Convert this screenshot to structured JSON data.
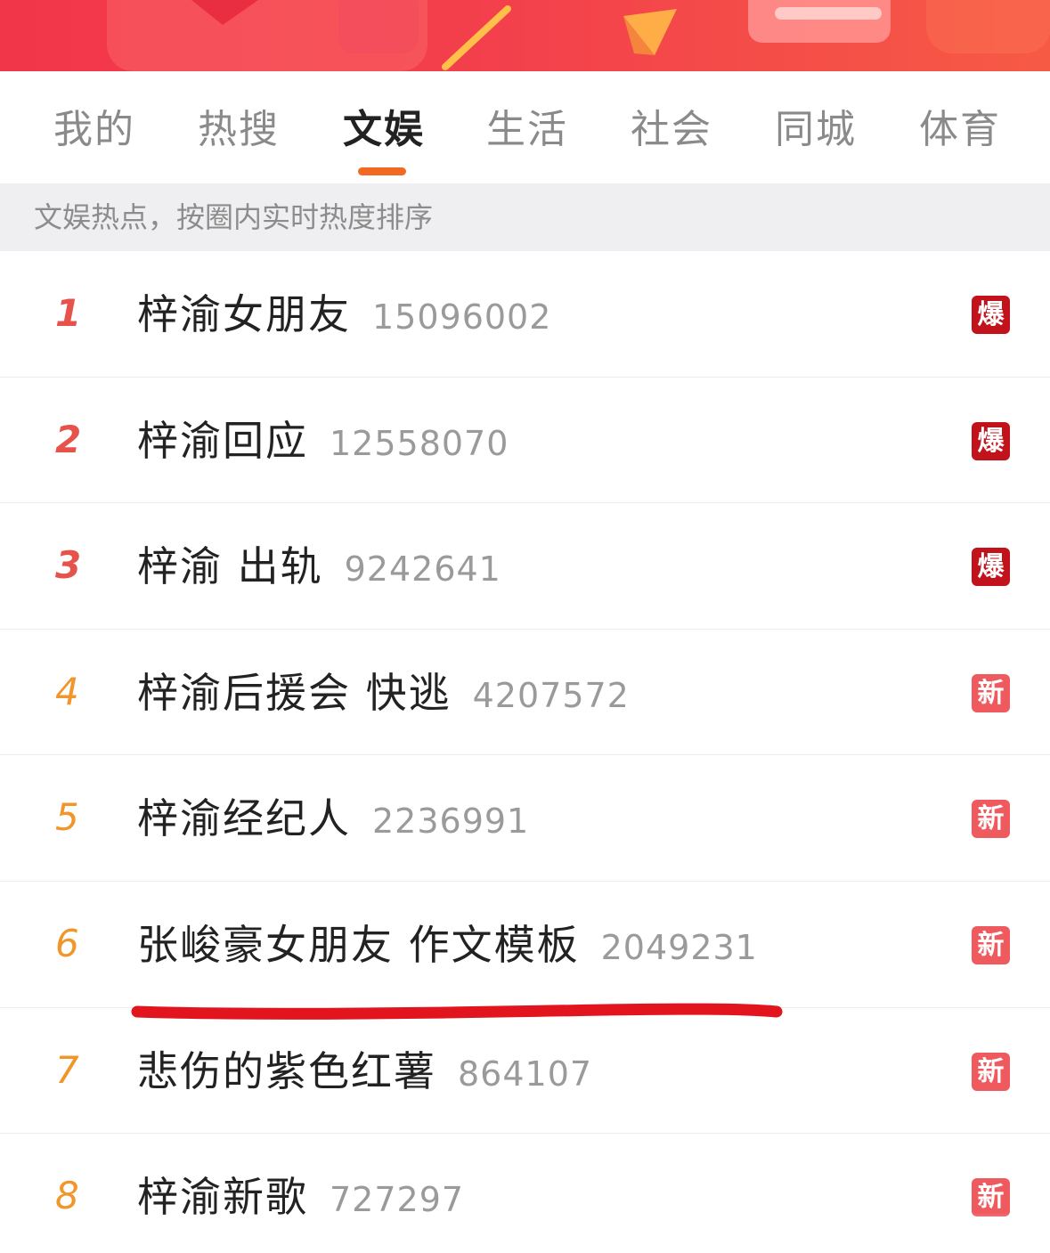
{
  "tabs": [
    {
      "label": "我的",
      "active": false
    },
    {
      "label": "热搜",
      "active": false
    },
    {
      "label": "文娱",
      "active": true
    },
    {
      "label": "生活",
      "active": false
    },
    {
      "label": "社会",
      "active": false
    },
    {
      "label": "同城",
      "active": false
    },
    {
      "label": "体育",
      "active": false
    }
  ],
  "info_text": "文娱热点，按圈内实时热度排序",
  "list": [
    {
      "rank": "1",
      "title": "梓渝女朋友",
      "count": "15096002",
      "badge": "爆"
    },
    {
      "rank": "2",
      "title": "梓渝回应",
      "count": "12558070",
      "badge": "爆"
    },
    {
      "rank": "3",
      "title": "梓渝 出轨",
      "count": "9242641",
      "badge": "爆"
    },
    {
      "rank": "4",
      "title": "梓渝后援会 快逃",
      "count": "4207572",
      "badge": "新"
    },
    {
      "rank": "5",
      "title": "梓渝经纪人",
      "count": "2236991",
      "badge": "新"
    },
    {
      "rank": "6",
      "title": "张峻豪女朋友 作文模板",
      "count": "2049231",
      "badge": "新"
    },
    {
      "rank": "7",
      "title": "悲伤的紫色红薯",
      "count": "864107",
      "badge": "新"
    },
    {
      "rank": "8",
      "title": "梓渝新歌",
      "count": "727297",
      "badge": "新"
    }
  ],
  "colors": {
    "accent": "#f26a21",
    "rank_top": "#e6534a",
    "rank_other": "#f0962a",
    "badge_hot": "#c2131c",
    "badge_new": "#ef5a5f",
    "annotation": "#e2141d"
  }
}
